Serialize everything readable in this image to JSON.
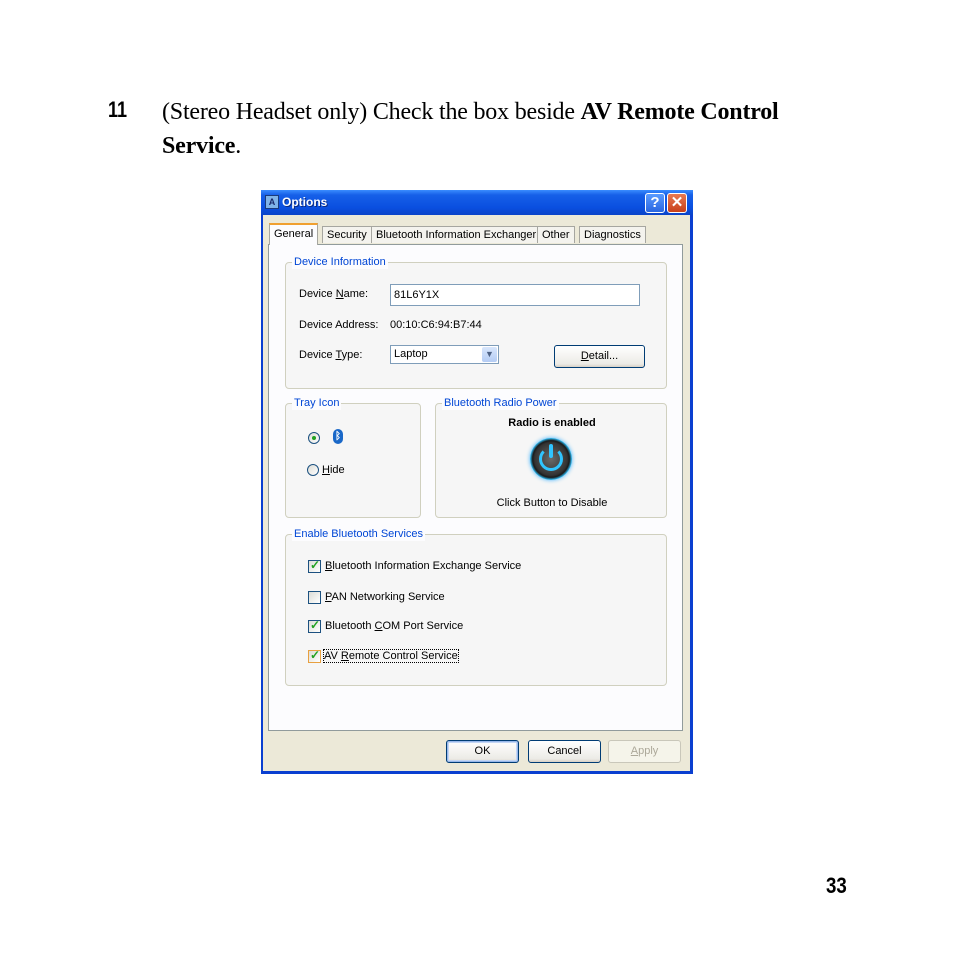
{
  "instruction": {
    "step_number": "11",
    "text_prefix": "(Stereo Headset only) Check the box beside ",
    "text_bold": "AV Remote Control Service",
    "text_suffix": "."
  },
  "page_number": "33",
  "dialog": {
    "title": "Options",
    "title_icon": "app-icon",
    "help_button": "?",
    "close_button": "✕",
    "tabs": [
      {
        "label": "General",
        "active": true
      },
      {
        "label": "Security",
        "active": false
      },
      {
        "label": "Bluetooth Information Exchanger",
        "active": false
      },
      {
        "label": "Other",
        "active": false
      },
      {
        "label": "Diagnostics",
        "active": false
      }
    ],
    "device_information": {
      "title": "Device Information",
      "name_label_pre": "Device ",
      "name_label_key": "N",
      "name_label_post": "ame:",
      "name_value": "81L6Y1X",
      "address_label": "Device Address:",
      "address_value": "00:10:C6:94:B7:44",
      "type_label_pre": "Device ",
      "type_label_key": "T",
      "type_label_post": "ype:",
      "type_value": "Laptop",
      "detail_button_key": "D",
      "detail_button_rest": "etail..."
    },
    "tray_icon": {
      "title": "Tray Icon",
      "show_selected": true,
      "show_icon": "bluetooth-icon",
      "hide_key": "H",
      "hide_rest": "ide"
    },
    "radio_power": {
      "title": "Bluetooth Radio Power",
      "status": "Radio is enabled",
      "action": "Click Button to Disable"
    },
    "services": {
      "title": "Enable Bluetooth Services",
      "items": [
        {
          "key": "B",
          "rest": "luetooth Information Exchange Service",
          "pre": "",
          "checked": true
        },
        {
          "key": "P",
          "rest": "AN Networking Service",
          "pre": "",
          "checked": false
        },
        {
          "key": "C",
          "rest": "OM Port Service",
          "pre": "Bluetooth ",
          "checked": true
        },
        {
          "key": "R",
          "rest": "emote Control Service",
          "pre": "AV ",
          "checked": true
        }
      ]
    },
    "buttons": {
      "ok": "OK",
      "cancel": "Cancel",
      "apply_key": "A",
      "apply_rest": "pply"
    }
  }
}
